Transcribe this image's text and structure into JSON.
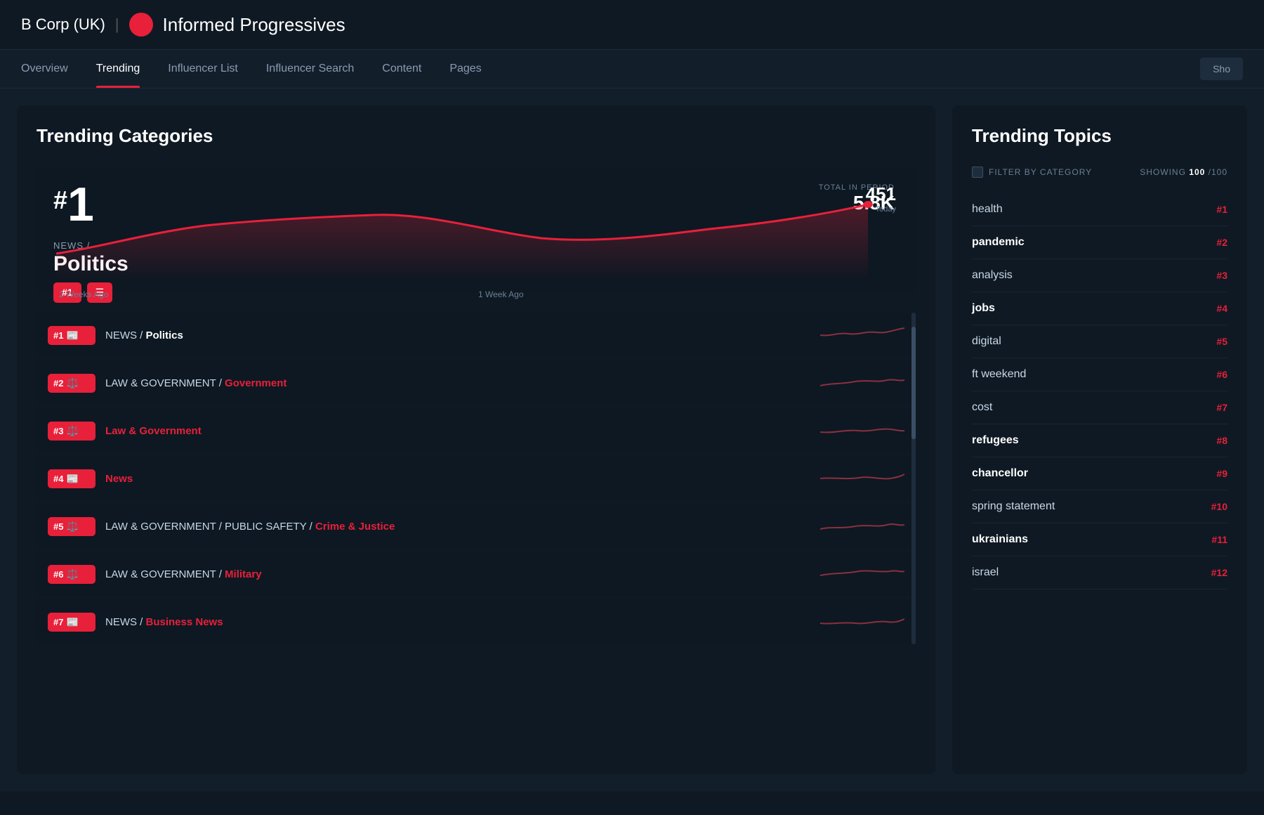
{
  "header": {
    "brand": "B Corp (UK)",
    "logo_color": "#e8203a",
    "title": "Informed Progressives"
  },
  "nav": {
    "items": [
      {
        "label": "Overview",
        "active": false
      },
      {
        "label": "Trending",
        "active": true
      },
      {
        "label": "Influencer List",
        "active": false
      },
      {
        "label": "Influencer Search",
        "active": false
      },
      {
        "label": "Content",
        "active": false
      },
      {
        "label": "Pages",
        "active": false
      }
    ],
    "show_button": "Sho"
  },
  "trending_categories": {
    "title": "Trending Categories",
    "featured": {
      "rank": "#",
      "rank_number": "1",
      "total_label": "TOTAL IN PERIOD",
      "total_value": "5.8K",
      "category": "NEWS /",
      "name": "Politics",
      "badge_rank": "#1",
      "today_value": "451",
      "today_label": "Today",
      "axis_left": "2 Weeks Ago",
      "axis_mid": "1 Week Ago",
      "axis_right": "Today"
    },
    "items": [
      {
        "rank": "#1",
        "icon": "📰",
        "label_prefix": "NEWS / ",
        "label_main": "Politics",
        "is_highlight": false
      },
      {
        "rank": "#2",
        "icon": "⚖️",
        "label_prefix": "LAW & GOVERNMENT / ",
        "label_main": "Government",
        "is_highlight": true
      },
      {
        "rank": "#3",
        "icon": "⚖️",
        "label_prefix": "",
        "label_main": "Law & Government",
        "is_highlight": true
      },
      {
        "rank": "#4",
        "icon": "📰",
        "label_prefix": "",
        "label_main": "News",
        "is_highlight": true
      },
      {
        "rank": "#5",
        "icon": "⚖️",
        "label_prefix": "LAW & GOVERNMENT / PUBLIC SAFETY / ",
        "label_main": "Crime & Justice",
        "is_highlight": true
      },
      {
        "rank": "#6",
        "icon": "⚖️",
        "label_prefix": "LAW & GOVERNMENT / ",
        "label_main": "Military",
        "is_highlight": true
      },
      {
        "rank": "#7",
        "icon": "📰",
        "label_prefix": "NEWS / ",
        "label_main": "Business News",
        "is_highlight": true
      }
    ]
  },
  "trending_topics": {
    "title": "Trending Topics",
    "filter_label": "FILTER BY CATEGORY",
    "showing_label": "SHOWING",
    "showing_value": "100",
    "showing_total": "/100",
    "items": [
      {
        "name": "health",
        "rank": "#1",
        "bold": false
      },
      {
        "name": "pandemic",
        "rank": "#2",
        "bold": true
      },
      {
        "name": "analysis",
        "rank": "#3",
        "bold": false
      },
      {
        "name": "jobs",
        "rank": "#4",
        "bold": true
      },
      {
        "name": "digital",
        "rank": "#5",
        "bold": false
      },
      {
        "name": "ft weekend",
        "rank": "#6",
        "bold": false
      },
      {
        "name": "cost",
        "rank": "#7",
        "bold": false
      },
      {
        "name": "refugees",
        "rank": "#8",
        "bold": true
      },
      {
        "name": "chancellor",
        "rank": "#9",
        "bold": true
      },
      {
        "name": "spring statement",
        "rank": "#10",
        "bold": false
      },
      {
        "name": "ukrainians",
        "rank": "#11",
        "bold": true
      },
      {
        "name": "israel",
        "rank": "#12",
        "bold": false
      }
    ]
  }
}
